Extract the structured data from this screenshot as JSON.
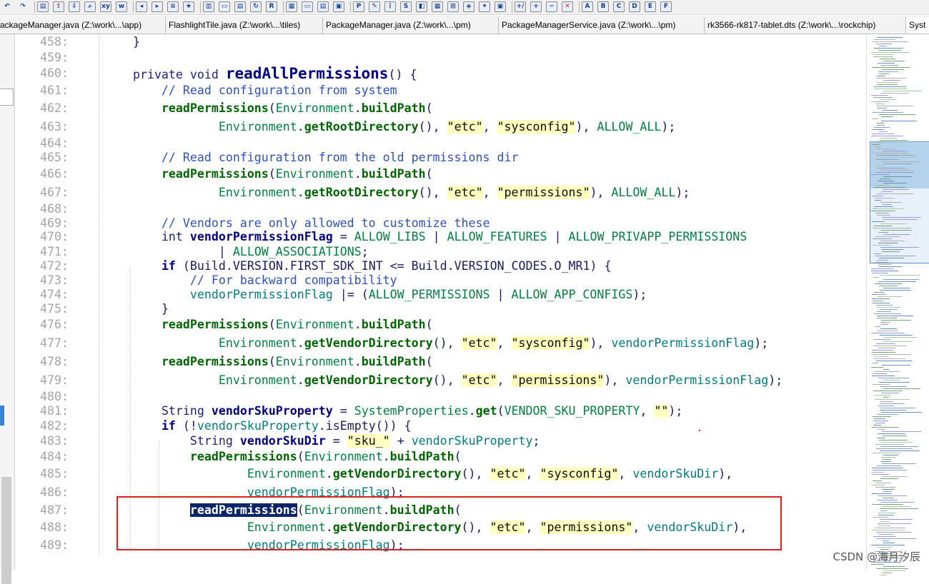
{
  "toolbar": {
    "buttons": [
      "undo-icon",
      "redo-icon",
      "sep",
      "page-icon",
      "export-icon",
      "import-icon",
      "find-icon",
      "replace-icon",
      "www-icon",
      "sep",
      "bookmark-prev-icon",
      "bookmark-next-icon",
      "bookmark-list-icon",
      "bookmark-star-icon",
      "sep",
      "book-icon",
      "folder-icon",
      "notes-icon",
      "refresh-icon",
      "r-logo-icon",
      "sep",
      "layout1-icon",
      "layout2-icon",
      "layout3-icon",
      "layout4-icon",
      "sep",
      "p-icon",
      "tool1-icon",
      "tool2-icon",
      "tool3-icon",
      "tool4-icon",
      "tool5-icon",
      "tool6-icon",
      "tool7-icon",
      "tool8-icon",
      "tool9-icon",
      "sep",
      "zoom-icon",
      "add-icon",
      "remove-icon",
      "close-icon",
      "sep",
      "a-icon",
      "b-icon",
      "c-icon",
      "d-icon",
      "e-icon",
      "f-icon"
    ]
  },
  "tabs": [
    {
      "label": "ackageManager.java (Z:\\work\\...\\app)"
    },
    {
      "label": "FlashlightTile.java (Z:\\work\\...\\tiles)"
    },
    {
      "label": "PackageManager.java (Z:\\work\\...\\pm)"
    },
    {
      "label": "PackageManagerService.java (Z:\\work\\...\\pm)"
    },
    {
      "label": "rk3566-rk817-tablet.dts (Z:\\work\\...\\rockchip)"
    },
    {
      "label": "Syst"
    }
  ],
  "code": {
    "lines": [
      {
        "n": "458:",
        "t": "    }"
      },
      {
        "n": "459:",
        "t": ""
      },
      {
        "n": "460:",
        "t": "    private void readAllPermissions() {"
      },
      {
        "n": "461:",
        "t": "        // Read configuration from system"
      },
      {
        "n": "462:",
        "t": "        readPermissions(Environment.buildPath("
      },
      {
        "n": "463:",
        "t": "                Environment.getRootDirectory(), \"etc\", \"sysconfig\"), ALLOW_ALL);"
      },
      {
        "n": "464:",
        "t": ""
      },
      {
        "n": "465:",
        "t": "        // Read configuration from the old permissions dir"
      },
      {
        "n": "466:",
        "t": "        readPermissions(Environment.buildPath("
      },
      {
        "n": "467:",
        "t": "                Environment.getRootDirectory(), \"etc\", \"permissions\"), ALLOW_ALL);"
      },
      {
        "n": "468:",
        "t": ""
      },
      {
        "n": "469:",
        "t": "        // Vendors are only allowed to customize these"
      },
      {
        "n": "470:",
        "t": "        int vendorPermissionFlag = ALLOW_LIBS | ALLOW_FEATURES | ALLOW_PRIVAPP_PERMISSIONS"
      },
      {
        "n": "471:",
        "t": "                | ALLOW_ASSOCIATIONS;"
      },
      {
        "n": "472:",
        "t": "        if (Build.VERSION.FIRST_SDK_INT <= Build.VERSION_CODES.O_MR1) {"
      },
      {
        "n": "473:",
        "t": "            // For backward compatibility"
      },
      {
        "n": "474:",
        "t": "            vendorPermissionFlag |= (ALLOW_PERMISSIONS | ALLOW_APP_CONFIGS);"
      },
      {
        "n": "475:",
        "t": "        }"
      },
      {
        "n": "476:",
        "t": "        readPermissions(Environment.buildPath("
      },
      {
        "n": "477:",
        "t": "                Environment.getVendorDirectory(), \"etc\", \"sysconfig\"), vendorPermissionFlag);"
      },
      {
        "n": "478:",
        "t": "        readPermissions(Environment.buildPath("
      },
      {
        "n": "479:",
        "t": "                Environment.getVendorDirectory(), \"etc\", \"permissions\"), vendorPermissionFlag);"
      },
      {
        "n": "480:",
        "t": ""
      },
      {
        "n": "481:",
        "t": "        String vendorSkuProperty = SystemProperties.get(VENDOR_SKU_PROPERTY, \"\");"
      },
      {
        "n": "482:",
        "t": "        if (!vendorSkuProperty.isEmpty()) {"
      },
      {
        "n": "483:",
        "t": "            String vendorSkuDir = \"sku_\" + vendorSkuProperty;"
      },
      {
        "n": "484:",
        "t": "            readPermissions(Environment.buildPath("
      },
      {
        "n": "485:",
        "t": "                    Environment.getVendorDirectory(), \"etc\", \"sysconfig\", vendorSkuDir),"
      },
      {
        "n": "486:",
        "t": "                    vendorPermissionFlag);"
      },
      {
        "n": "487:",
        "t": "            readPermissions(Environment.buildPath("
      },
      {
        "n": "488:",
        "t": "                    Environment.getVendorDirectory(), \"etc\", \"permissions\", vendorSkuDir),"
      },
      {
        "n": "489:",
        "t": "                    vendorPermissionFlag);"
      }
    ]
  },
  "watermark": "CSDN @海月汐辰",
  "colors": {
    "highlight_box": "#e02020",
    "selection": "#0a246a",
    "string_bg": "#ffffc0",
    "method": "#006400",
    "comment": "#2e4fbf"
  }
}
